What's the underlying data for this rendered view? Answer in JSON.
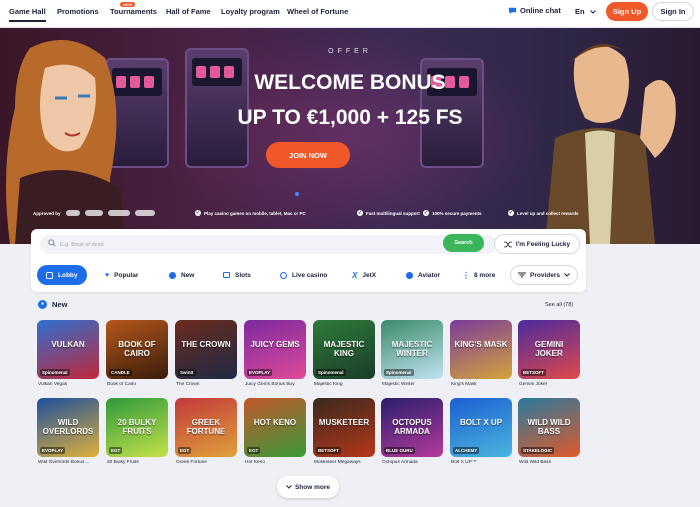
{
  "nav": {
    "items": [
      "Game Hall",
      "Promotions",
      "Tournaments",
      "Hall of Fame",
      "Loyalty program",
      "Wheel of Fortune"
    ],
    "new_badge": "NEW",
    "online_chat": "Online chat",
    "language": "En",
    "signup": "Sign Up",
    "signin": "Sign In"
  },
  "hero": {
    "eyebrow": "OFFER",
    "title": "WELCOME BONUS",
    "subtitle": "UP TO €1,000 + 125 FS",
    "cta": "JOIN NOW",
    "approved_by": "Approved by",
    "features": [
      "Play casino games on mobile, tablet, Mac or PC",
      "Fast multilingual support",
      "100% secure payments",
      "Level up and collect rewards"
    ]
  },
  "search": {
    "placeholder": "E.g. Book of dead",
    "button": "Search",
    "lucky": "I'm Feeling Lucky"
  },
  "categories": [
    "Lobby",
    "Popular",
    "New",
    "Slots",
    "Live casino",
    "JetX",
    "Aviator",
    "8 more"
  ],
  "providers_label": "Providers",
  "new_section": {
    "title": "New",
    "see_all": "See all (78)"
  },
  "games": [
    {
      "name": "Vulkan Vegas",
      "art": "VULKAN",
      "badge": "Spinomenal",
      "colors": [
        "#2f6fd0",
        "#c0283a"
      ]
    },
    {
      "name": "Book of Cairo",
      "art": "BOOK OF CAIRO",
      "badge": "CANDLE",
      "colors": [
        "#b5571a",
        "#3a1d0c"
      ]
    },
    {
      "name": "The Crown",
      "art": "THE CROWN",
      "badge": "Swintt",
      "colors": [
        "#6b2b1e",
        "#1f2a44"
      ]
    },
    {
      "name": "Juicy Gems Bonus Buy",
      "art": "JUICY GEMS",
      "badge": "EVOPLAY",
      "colors": [
        "#7b2a9e",
        "#e04a9a"
      ]
    },
    {
      "name": "Majestic King",
      "art": "MAJESTIC KING",
      "badge": "Spinomenal",
      "colors": [
        "#2e7a3a",
        "#1b3e2a"
      ]
    },
    {
      "name": "Majestic Winter",
      "art": "MAJESTIC WINTER",
      "badge": "Spinomenal",
      "colors": [
        "#3c8a6a",
        "#bfe3f2"
      ]
    },
    {
      "name": "King's Mask",
      "art": "KING'S MASK",
      "badge": "",
      "colors": [
        "#7a3b9c",
        "#d4a33a"
      ]
    },
    {
      "name": "Gemini Joker",
      "art": "GEMINI JOKER",
      "badge": "BETSOFT",
      "colors": [
        "#4a2a9e",
        "#e04a4a"
      ]
    },
    {
      "name": "Wild Overlords Bonus ...",
      "art": "WILD OVERLORDS",
      "badge": "EVOPLAY",
      "colors": [
        "#1d4f9e",
        "#e0b13a"
      ]
    },
    {
      "name": "20 Bulky Fruits",
      "art": "20 BULKY FRUITS",
      "badge": "EGT",
      "colors": [
        "#2e9a3a",
        "#c5e04a"
      ]
    },
    {
      "name": "Greek Fortune",
      "art": "GREEK FORTUNE",
      "badge": "EGT",
      "colors": [
        "#c23a3a",
        "#e0a03a"
      ]
    },
    {
      "name": "Hot Keno",
      "art": "HOT KENO",
      "badge": "EGT",
      "colors": [
        "#c2572a",
        "#3a9a3a"
      ]
    },
    {
      "name": "Musketeer Megaways",
      "art": "MUSKETEER",
      "badge": "BETSOFT",
      "colors": [
        "#3a2a1e",
        "#b5371a"
      ]
    },
    {
      "name": "Octopus Armada",
      "art": "OCTOPUS ARMADA",
      "badge": "BLUE GURU",
      "colors": [
        "#2a1e6e",
        "#b53a9a"
      ]
    },
    {
      "name": "Bolt X UP™",
      "art": "BOLT X UP",
      "badge": "ALCHEMY",
      "colors": [
        "#1d5fd0",
        "#4ab5e0"
      ]
    },
    {
      "name": "Wild Wild Bass",
      "art": "WILD WILD BASS",
      "badge": "STAKELOGIC",
      "colors": [
        "#2a7a9e",
        "#e05a2a"
      ]
    }
  ],
  "show_more": "Show more"
}
